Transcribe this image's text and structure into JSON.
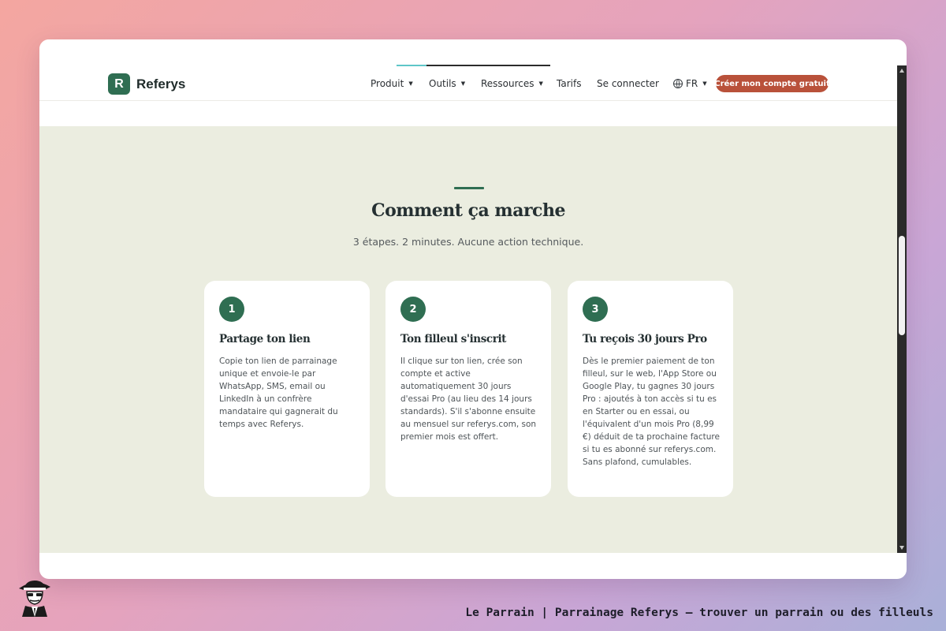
{
  "header": {
    "logo_letter": "R",
    "brand": "Referys",
    "nav": [
      {
        "label": "Produit",
        "dropdown": true
      },
      {
        "label": "Outils",
        "dropdown": true
      },
      {
        "label": "Ressources",
        "dropdown": true
      },
      {
        "label": "Tarifs",
        "dropdown": false
      },
      {
        "label": "Se connecter",
        "dropdown": false
      }
    ],
    "lang": "FR",
    "cta": "Créer mon compte gratuit"
  },
  "section": {
    "title": "Comment ça marche",
    "subtitle": "3 étapes. 2 minutes. Aucune action technique.",
    "steps": [
      {
        "number": "1",
        "title": "Partage ton lien",
        "text": "Copie ton lien de parrainage unique et envoie-le par WhatsApp, SMS, email ou LinkedIn à un confrère mandataire qui gagnerait du temps avec Referys."
      },
      {
        "number": "2",
        "title": "Ton filleul s'inscrit",
        "text": "Il clique sur ton lien, crée son compte et active automatiquement 30 jours d'essai Pro (au lieu des 14 jours standards). S'il s'abonne ensuite au mensuel sur referys.com, son premier mois est offert."
      },
      {
        "number": "3",
        "title": "Tu reçois 30 jours Pro",
        "text": "Dès le premier paiement de ton filleul, sur le web, l'App Store ou Google Play, tu gagnes 30 jours Pro : ajoutés à ton accès si tu es en Starter ou en essai, ou l'équivalent d'un mois Pro (8,99 €) déduit de ta prochaine facture si tu es abonné sur referys.com. Sans plafond, cumulables."
      }
    ]
  },
  "footer": {
    "caption": "Le Parrain | Parrainage Referys — trouver un parrain ou des filleuls"
  },
  "colors": {
    "brand_green": "#2f6e52",
    "cta_red": "#b9513a",
    "section_bg": "#ebede0"
  }
}
